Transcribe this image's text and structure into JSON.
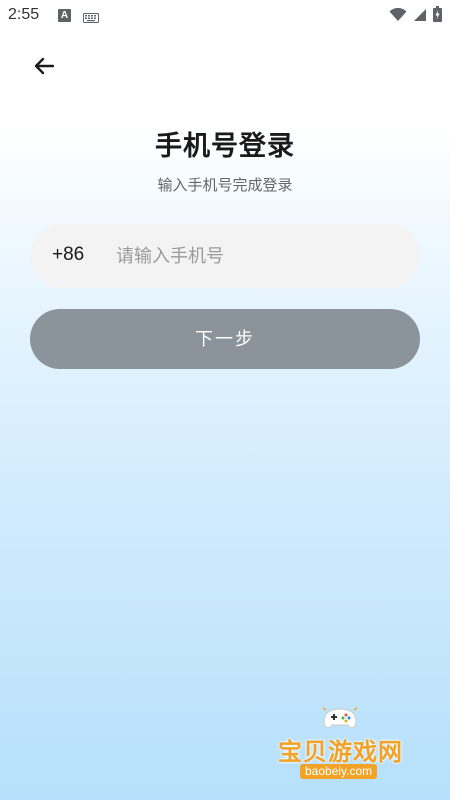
{
  "status_bar": {
    "time": "2:55",
    "a_badge": "A"
  },
  "header": {
    "back_icon": "arrow-left-icon"
  },
  "main": {
    "title": "手机号登录",
    "subtitle": "输入手机号完成登录",
    "phone": {
      "country_code": "+86",
      "value": "",
      "placeholder": "请输入手机号"
    },
    "next_button_label": "下一步",
    "next_button_color": "#8b949a"
  },
  "watermark": {
    "name": "宝贝游戏网",
    "url": "baobeiy.com",
    "color": "#f2a227"
  }
}
